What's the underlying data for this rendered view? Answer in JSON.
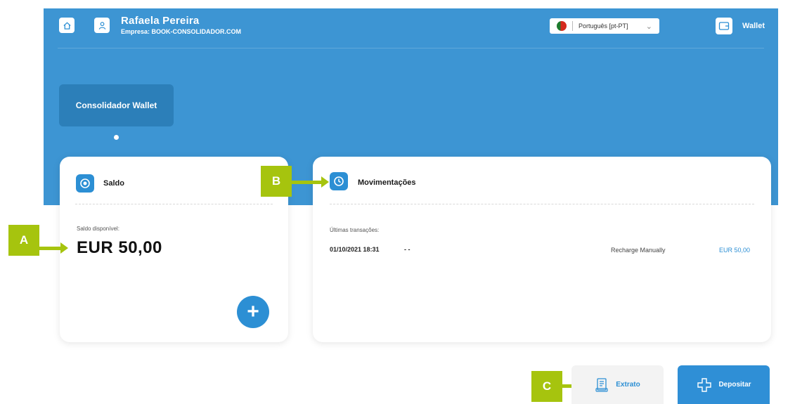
{
  "header": {
    "user_name": "Rafaela Pereira",
    "company": "Empresa: BOOK-CONSOLIDADOR.COM",
    "language": "Português [pt-PT]",
    "wallet_label": "Wallet"
  },
  "wallet_tab": {
    "label": "Consolidador Wallet"
  },
  "balance_card": {
    "title": "Saldo",
    "available_label": "Saldo disponível:",
    "amount": "EUR 50,00"
  },
  "movements_card": {
    "title": "Movimentações",
    "recent_label": "Últimas transações:",
    "transactions": [
      {
        "date": "01/10/2021 18:31",
        "ref": "- -",
        "description": "Recharge Manually",
        "amount": "EUR 50,00"
      }
    ]
  },
  "actions": {
    "statement_label": "Extrato",
    "deposit_label": "Depositar"
  },
  "annotations": {
    "a": "A",
    "b": "B",
    "c": "C"
  },
  "colors": {
    "brand_blue": "#3d95d3",
    "accent_blue": "#2c8fd4",
    "annotation_green": "#a6c40e"
  }
}
